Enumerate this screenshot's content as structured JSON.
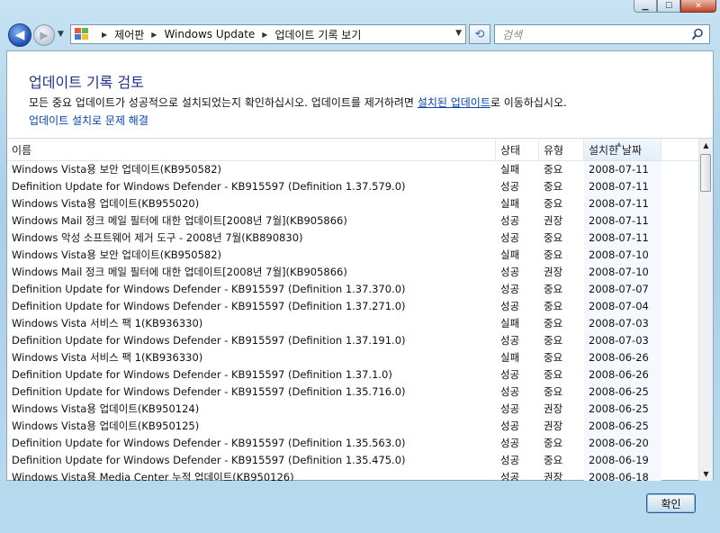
{
  "window": {
    "caption": {
      "minimize": "▁",
      "maximize": "☐",
      "close": "✕"
    }
  },
  "nav": {
    "back_glyph": "◀",
    "forward_glyph": "▶",
    "history_glyph": "▼",
    "breadcrumb": [
      "제어판",
      "Windows Update",
      "업데이트 기록 보기"
    ],
    "breadcrumb_separator": "▶",
    "address_dropdown_glyph": "▼",
    "refresh_glyph": "⟲",
    "search_placeholder": "검색"
  },
  "page": {
    "title": "업데이트 기록 검토",
    "desc_prefix": "모든 중요 업데이트가 성공적으로 설치되었는지 확인하십시오. 업데이트를 제거하려면 ",
    "desc_link": "설치된 업데이트",
    "desc_suffix": "로 이동하십시오.",
    "help_link": "업데이트 설치로 문제 해결"
  },
  "table": {
    "columns": {
      "name": "이름",
      "status": "상태",
      "type": "유형",
      "date": "설치한 날짜"
    },
    "sort_indicator": "▲",
    "rows": [
      {
        "name": "Windows Vista용 보안 업데이트(KB950582)",
        "status": "실패",
        "type": "중요",
        "date": "2008-07-11"
      },
      {
        "name": "Definition Update for Windows Defender - KB915597 (Definition 1.37.579.0)",
        "status": "성공",
        "type": "중요",
        "date": "2008-07-11"
      },
      {
        "name": "Windows Vista용 업데이트(KB955020)",
        "status": "실패",
        "type": "중요",
        "date": "2008-07-11"
      },
      {
        "name": "Windows Mail 정크 메일 필터에 대한 업데이트[2008년 7월](KB905866)",
        "status": "성공",
        "type": "권장",
        "date": "2008-07-11"
      },
      {
        "name": "Windows 악성 소프트웨어 제거 도구 - 2008년 7월(KB890830)",
        "status": "성공",
        "type": "중요",
        "date": "2008-07-11"
      },
      {
        "name": "Windows Vista용 보안 업데이트(KB950582)",
        "status": "실패",
        "type": "중요",
        "date": "2008-07-10"
      },
      {
        "name": "Windows Mail 정크 메일 필터에 대한 업데이트[2008년 7월](KB905866)",
        "status": "성공",
        "type": "권장",
        "date": "2008-07-10"
      },
      {
        "name": "Definition Update for Windows Defender - KB915597 (Definition 1.37.370.0)",
        "status": "성공",
        "type": "중요",
        "date": "2008-07-07"
      },
      {
        "name": "Definition Update for Windows Defender - KB915597 (Definition 1.37.271.0)",
        "status": "성공",
        "type": "중요",
        "date": "2008-07-04"
      },
      {
        "name": "Windows Vista 서비스 팩 1(KB936330)",
        "status": "실패",
        "type": "중요",
        "date": "2008-07-03"
      },
      {
        "name": "Definition Update for Windows Defender - KB915597 (Definition 1.37.191.0)",
        "status": "성공",
        "type": "중요",
        "date": "2008-07-03"
      },
      {
        "name": "Windows Vista 서비스 팩 1(KB936330)",
        "status": "실패",
        "type": "중요",
        "date": "2008-06-26"
      },
      {
        "name": "Definition Update for Windows Defender - KB915597 (Definition 1.37.1.0)",
        "status": "성공",
        "type": "중요",
        "date": "2008-06-26"
      },
      {
        "name": "Definition Update for Windows Defender - KB915597 (Definition 1.35.716.0)",
        "status": "성공",
        "type": "중요",
        "date": "2008-06-25"
      },
      {
        "name": "Windows Vista용 업데이트(KB950124)",
        "status": "성공",
        "type": "권장",
        "date": "2008-06-25"
      },
      {
        "name": "Windows Vista용 업데이트(KB950125)",
        "status": "성공",
        "type": "권장",
        "date": "2008-06-25"
      },
      {
        "name": "Definition Update for Windows Defender - KB915597 (Definition 1.35.563.0)",
        "status": "성공",
        "type": "중요",
        "date": "2008-06-20"
      },
      {
        "name": "Definition Update for Windows Defender - KB915597 (Definition 1.35.475.0)",
        "status": "성공",
        "type": "중요",
        "date": "2008-06-19"
      },
      {
        "name": "Windows Vista용 Media Center 누적 업데이트(KB950126)",
        "status": "성공",
        "type": "권장",
        "date": "2008-06-18"
      }
    ]
  },
  "scrollbar": {
    "up_glyph": "▲",
    "down_glyph": "▼"
  },
  "footer": {
    "ok_label": "확인"
  }
}
